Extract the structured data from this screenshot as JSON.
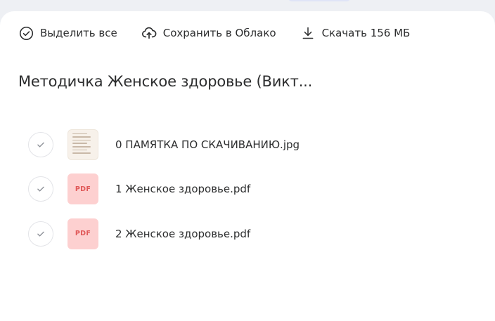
{
  "toolbar": {
    "select_all_label": "Выделить все",
    "save_cloud_label": "Сохранить в Облако",
    "download_label": "Скачать 156 МБ"
  },
  "folder": {
    "title": "Методичка Женское здоровье (Викт..."
  },
  "files": [
    {
      "name": "0 ПАМЯТКА ПО СКАЧИВАНИЮ.jpg",
      "type": "image"
    },
    {
      "name": "1 Женское здоровье.pdf",
      "type": "pdf",
      "badge": "PDF"
    },
    {
      "name": "2 Женское здоровье.pdf",
      "type": "pdf",
      "badge": "PDF"
    }
  ],
  "colors": {
    "background": "#eef0f4",
    "panel": "#ffffff",
    "pdf_badge_bg": "#fdd0d0",
    "pdf_badge_text": "#e05858",
    "text": "#2c2d2e"
  }
}
